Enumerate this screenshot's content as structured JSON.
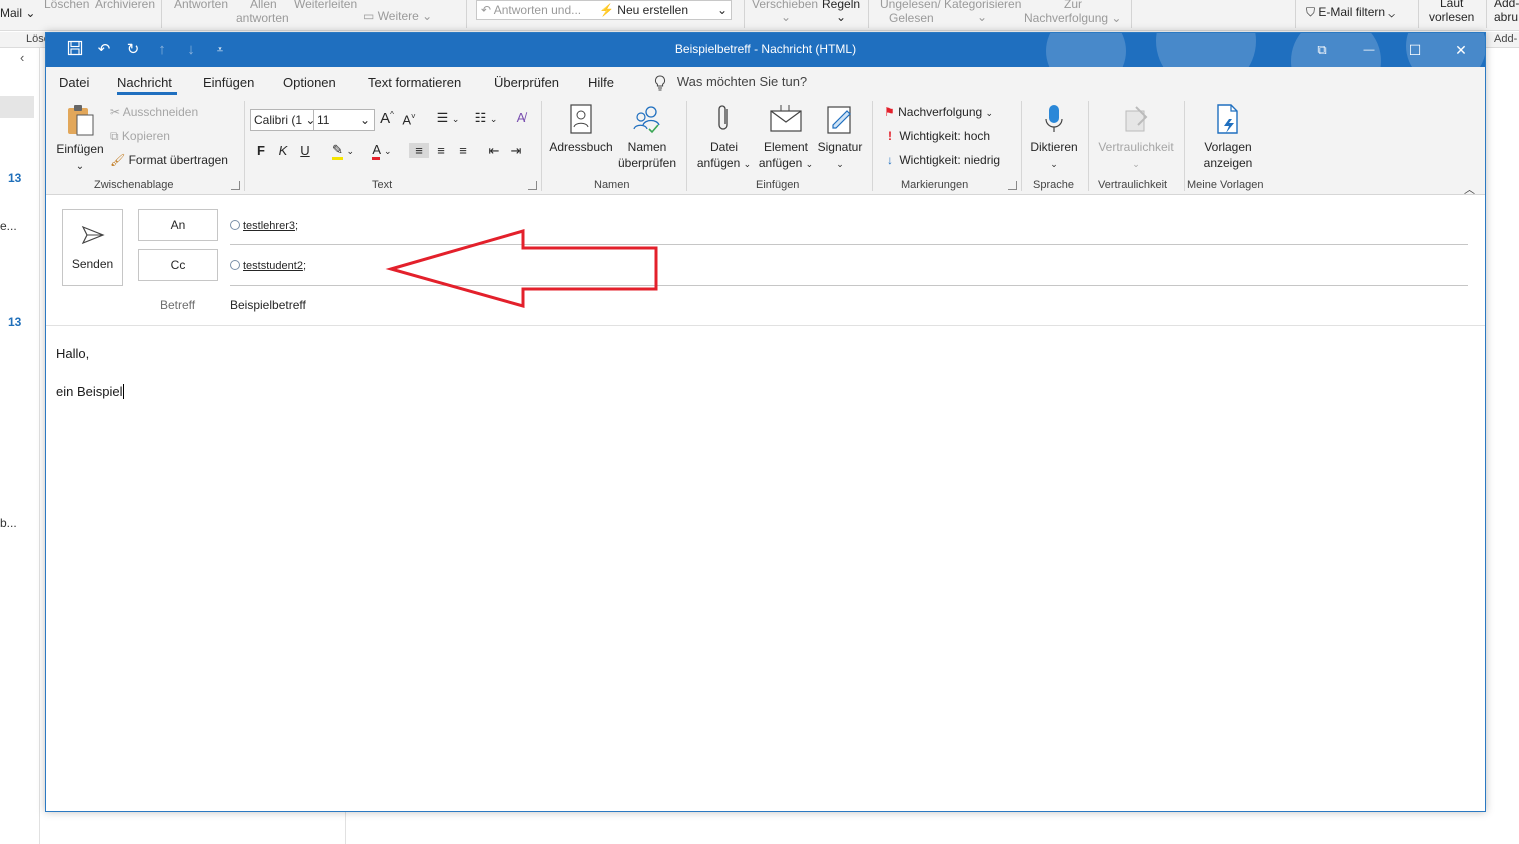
{
  "background": {
    "ribbon_items": {
      "mail": "Mail",
      "loeschen": "Löschen",
      "archivieren": "Archivieren",
      "antworten": "Antworten",
      "allen": "Allen",
      "allen_antworten": "antworten",
      "weiterleiten": "Weiterleiten",
      "weitere": "Weitere",
      "quicksteps_item1": "Antworten und...",
      "quicksteps_item2": "Neu erstellen",
      "verschieben": "Verschieben",
      "regeln": "Regeln",
      "ungelesen": "Ungelesen/",
      "gelesen": "Gelesen",
      "kategorisieren": "Kategorisieren",
      "zur": "Zur",
      "nachverfolgung": "Nachverfolgung",
      "email_filtern": "E-Mail filtern",
      "laut": "Laut",
      "vorlesen": "vorlesen",
      "addins1": "Add-",
      "addins2": "abru",
      "sub_loesch": "Lösc",
      "sub_addin": "Add-"
    },
    "left_list": {
      "count1": "13",
      "text1": "e...",
      "count2": "13",
      "text2": "b..."
    }
  },
  "window": {
    "title": "Beispielbetreff  -  Nachricht (HTML)",
    "qat": {
      "save_icon": "save-icon",
      "undo_icon": "undo-icon",
      "redo_icon": "redo-icon",
      "up_icon": "arrow-up-icon",
      "down_icon": "arrow-down-icon",
      "customize_icon": "customize-qat-icon"
    },
    "controls": {
      "restore_glyph": "⧉",
      "minimize_glyph": "—",
      "maximize_glyph": "☐",
      "close_glyph": "✕"
    }
  },
  "tabs": [
    {
      "label": "Datei"
    },
    {
      "label": "Nachricht"
    },
    {
      "label": "Einfügen"
    },
    {
      "label": "Optionen"
    },
    {
      "label": "Text formatieren"
    },
    {
      "label": "Überprüfen"
    },
    {
      "label": "Hilfe"
    }
  ],
  "tell_me": "Was möchten Sie tun?",
  "ribbon": {
    "clipboard": {
      "paste_label": "Einfügen",
      "cut_label": "Ausschneiden",
      "copy_label": "Kopieren",
      "format_painter_label": "Format übertragen",
      "group_label": "Zwischenablage"
    },
    "text": {
      "font_name": "Calibri (1",
      "font_size": "11",
      "bold": "F",
      "italic": "K",
      "underline": "U",
      "grow": "A",
      "shrink": "A",
      "group_label": "Text"
    },
    "names": {
      "addressbook_label": "Adressbuch",
      "check_names_line1": "Namen",
      "check_names_line2": "überprüfen",
      "group_label": "Namen"
    },
    "include": {
      "attach_file_line1": "Datei",
      "attach_file_line2": "anfügen",
      "attach_item_line1": "Element",
      "attach_item_line2": "anfügen",
      "signature_label": "Signatur",
      "group_label": "Einfügen"
    },
    "tags": {
      "followup_label": "Nachverfolgung",
      "high_importance_label": "Wichtigkeit: hoch",
      "low_importance_label": "Wichtigkeit: niedrig",
      "group_label": "Markierungen"
    },
    "voice": {
      "dictate_label": "Diktieren",
      "group_label": "Sprache"
    },
    "sensitivity": {
      "sensitivity_label": "Vertraulichkeit",
      "group_label": "Vertraulichkeit"
    },
    "templates": {
      "view_templates_line1": "Vorlagen",
      "view_templates_line2": "anzeigen",
      "group_label": "Meine Vorlagen"
    }
  },
  "compose": {
    "send_label": "Senden",
    "to_button": "An",
    "cc_button": "Cc",
    "to_recipient": "testlehrer3",
    "cc_recipient": "teststudent2",
    "recipient_separator": ";",
    "subject_label": "Betreff",
    "subject_value": "Beispielbetreff",
    "body_line1": "Hallo,",
    "body_line2": "ein Beispiel"
  },
  "annotation": {
    "arrow_color": "#e3202b"
  },
  "colors": {
    "titlebar": "#1f6fbf",
    "ribbon_bg": "#f3f3f3",
    "accent": "#1f6fbf"
  }
}
